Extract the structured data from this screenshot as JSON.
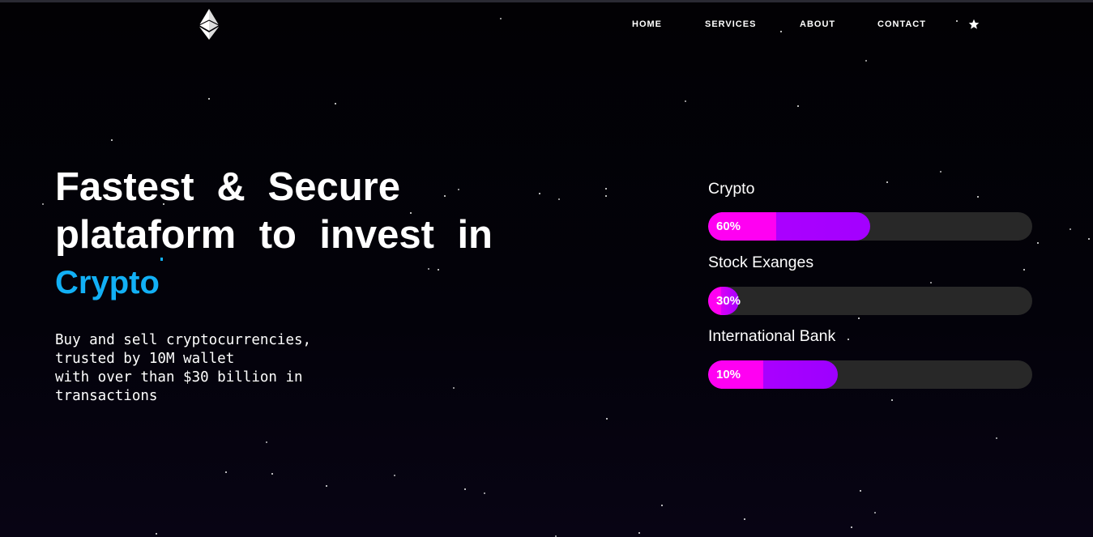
{
  "nav": {
    "items": [
      {
        "label": "HOME"
      },
      {
        "label": "SERVICES"
      },
      {
        "label": "ABOUT"
      },
      {
        "label": "CONTACT"
      }
    ]
  },
  "hero": {
    "title_line1": "Fastest & Secure",
    "title_line2": "plataform to invest in",
    "accent": "Crypto",
    "description": [
      "Buy and sell cryptocurrencies,",
      "trusted by 10M wallet",
      "with over than $30 billion in",
      "transactions"
    ]
  },
  "skills": [
    {
      "label": "Crypto",
      "percent_text": "60%",
      "fill_fraction": 0.5
    },
    {
      "label": "Stock Exanges",
      "percent_text": "30%",
      "fill_fraction": 0.1
    },
    {
      "label": "International Bank",
      "percent_text": "10%",
      "fill_fraction": 0.4
    }
  ],
  "colors": {
    "accent": "#12b0f5",
    "bar_track": "#282828",
    "bar_fill_start": "#ff00f2",
    "bar_fill_end": "#9300ff",
    "background": "#020104"
  },
  "icons": {
    "logo": "ethereum-logo-icon",
    "nav_extra": "star-icon"
  }
}
